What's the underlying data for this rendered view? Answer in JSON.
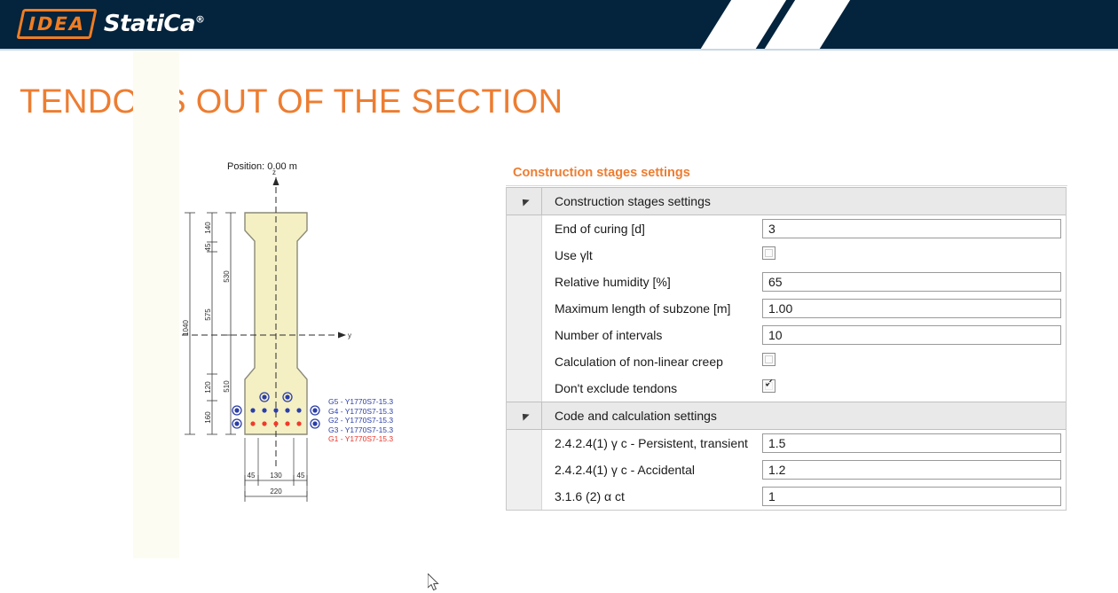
{
  "header": {
    "logo_mark": "IDEA",
    "logo_word": "StatiCa",
    "logo_registered": "®",
    "navy": "#04233c",
    "orange": "#f07d22"
  },
  "slide": {
    "title": "TENDONS OUT OF THE SECTION",
    "title_color": "#ed7d31"
  },
  "drawing": {
    "position_label": "Position: 0.00 m",
    "axis_z": "z",
    "axis_y": "y",
    "section_fill": "#f4f0c4",
    "section_stroke": "#8a8a78",
    "vertical_dimensions_outer": [
      "1040"
    ],
    "vertical_dimensions_chain": [
      "140",
      "45",
      "575",
      "120",
      "160"
    ],
    "vertical_dimensions_inner": [
      "530",
      "510"
    ],
    "horizontal_dimensions_chain": [
      "45",
      "130",
      "45"
    ],
    "horizontal_dimensions_total": [
      "220"
    ],
    "legend": [
      {
        "name": "G5",
        "material": "Y1770S7-15.3",
        "color": "#2b3ea8"
      },
      {
        "name": "G4",
        "material": "Y1770S7-15.3",
        "color": "#2b3ea8"
      },
      {
        "name": "G2",
        "material": "Y1770S7-15.3",
        "color": "#2b3ea8"
      },
      {
        "name": "G3",
        "material": "Y1770S7-15.3",
        "color": "#2b3ea8"
      },
      {
        "name": "G1",
        "material": "Y1770S7-15.3",
        "color": "#e8342a"
      }
    ],
    "tendon_blue": "#2b3ea8",
    "tendon_red": "#ef3b2c"
  },
  "panel": {
    "title": "Construction stages settings",
    "groups": [
      {
        "label": "Construction stages settings",
        "rows": [
          {
            "label": "End of curing [d]",
            "type": "text",
            "value": "3"
          },
          {
            "label": "Use γlt",
            "type": "checkbox",
            "checked": false
          },
          {
            "label": "Relative humidity [%]",
            "type": "text",
            "value": "65"
          },
          {
            "label": "Maximum length of subzone [m]",
            "type": "text",
            "value": "1.00"
          },
          {
            "label": "Number of intervals",
            "type": "text",
            "value": "10"
          },
          {
            "label": "Calculation of non-linear creep",
            "type": "checkbox",
            "checked": false
          },
          {
            "label": "Don't exclude tendons",
            "type": "checkbox",
            "checked": true
          }
        ]
      },
      {
        "label": "Code and calculation settings",
        "rows": [
          {
            "label": "2.4.2.4(1) γ c - Persistent, transient",
            "type": "text",
            "value": "1.5"
          },
          {
            "label": "2.4.2.4(1) γ c - Accidental",
            "type": "text",
            "value": "1.2"
          },
          {
            "label": "3.1.6 (2) α ct",
            "type": "text",
            "value": "1"
          }
        ]
      }
    ]
  }
}
